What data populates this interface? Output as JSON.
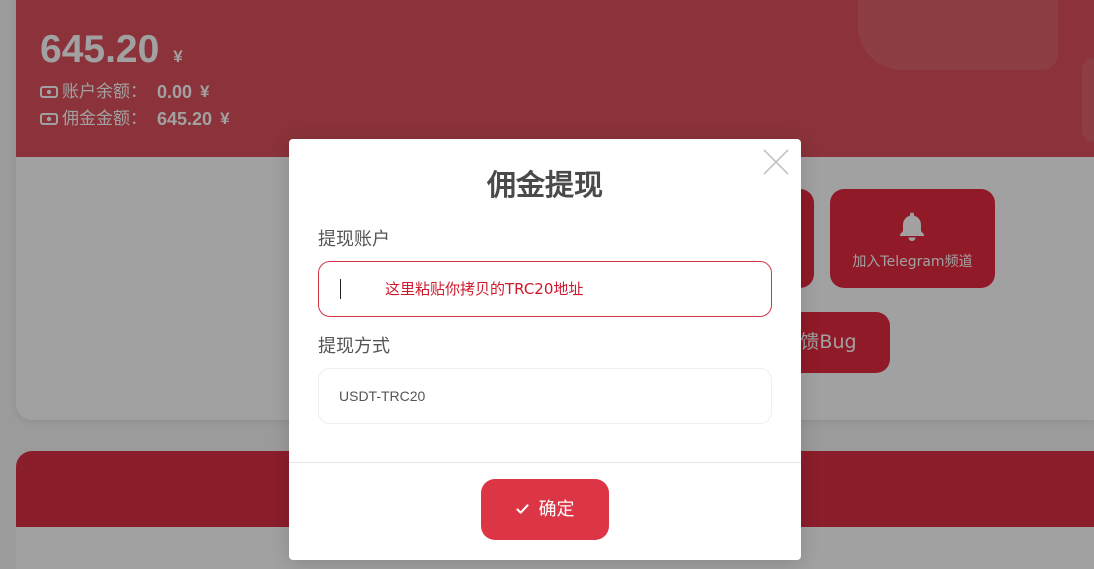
{
  "balance_card": {
    "total_amount": "645.20",
    "total_currency": "¥",
    "rows": [
      {
        "icon": "money-bill-icon",
        "label": "账户余额：",
        "amount": "0.00",
        "currency": "¥"
      },
      {
        "icon": "money-bill-icon",
        "label": "佣金金额：",
        "amount": "645.20",
        "currency": "¥"
      }
    ]
  },
  "actions": {
    "telegram": {
      "icon": "bell-icon",
      "label": "加入Telegram频道"
    },
    "feedback": {
      "label": "反馈Bug"
    }
  },
  "withdraw_modal": {
    "title": "佣金提现",
    "close_icon": "close-icon",
    "account_label": "提现账户",
    "account_placeholder": "这里粘贴你拷贝的TRC20地址",
    "method_label": "提现方式",
    "method_value": "USDT-TRC20",
    "confirm_icon": "check-icon",
    "confirm_label": "确定"
  },
  "colors": {
    "header_red": "#dc505c",
    "band_red": "#dc3044",
    "button_red": "#e52a3e",
    "accent": "#dc3545",
    "input_border": "#d43545",
    "placeholder": "#d0182c",
    "backdrop": "rgba(0,0,0,0.37)"
  }
}
